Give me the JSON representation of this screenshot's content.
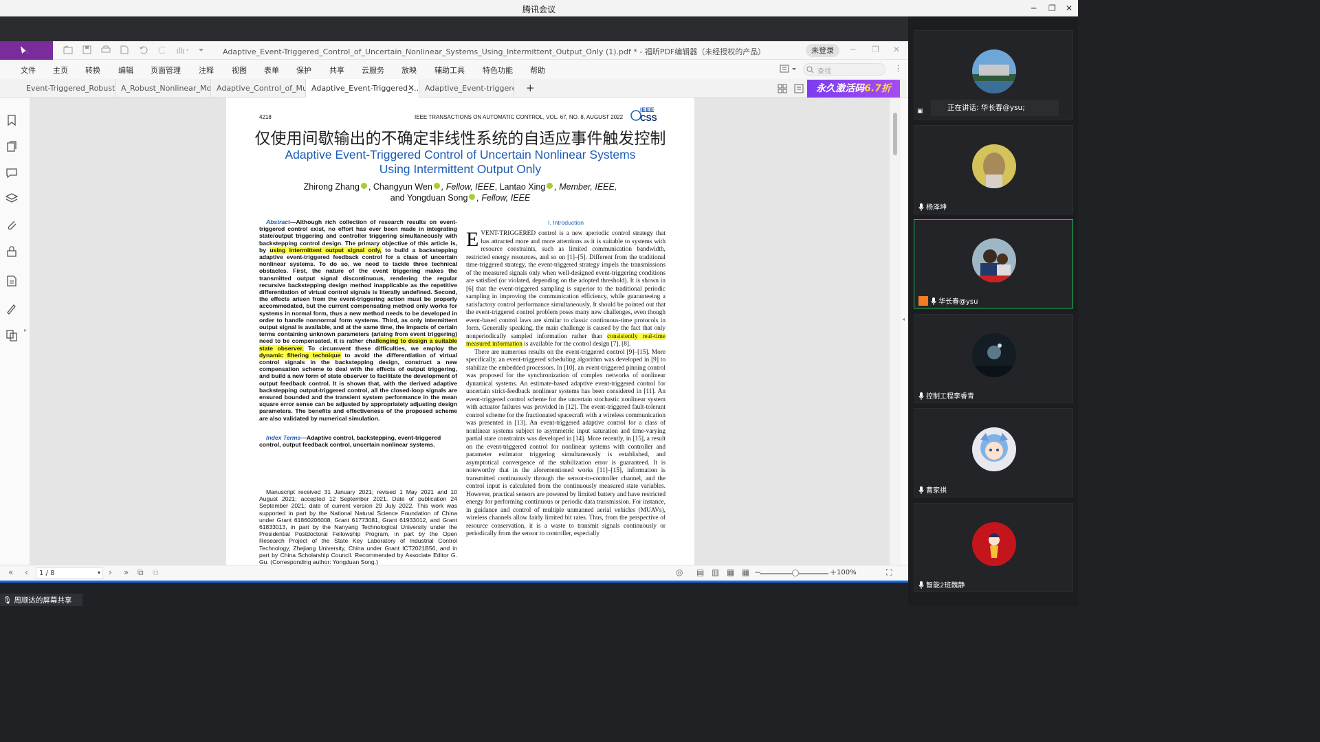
{
  "window": {
    "title": "腾讯会议",
    "controls": [
      "─",
      "❐",
      "✕"
    ]
  },
  "pdf": {
    "doc_title": "Adaptive_Event-Triggered_Control_of_Uncertain_Nonlinear_Systems_Using_Intermittent_Output_Only (1).pdf * - 福昕PDF编辑器（未经授权的产品）",
    "login_label": "未登录",
    "menu": [
      "文件",
      "主页",
      "转换",
      "编辑",
      "页面管理",
      "注释",
      "视图",
      "表单",
      "保护",
      "共享",
      "云服务",
      "放映",
      "辅助工具",
      "特色功能",
      "帮助"
    ],
    "search_placeholder": "查找",
    "tabs": [
      "Event-Triggered_Robust_...",
      "A_Robust_Nonlinear_Mod...",
      "Adaptive_Control_of_Multi...",
      "Adaptive_Event-Triggered_...",
      "Adaptive_Event-triggered..."
    ],
    "active_tab": 3,
    "add_tab": "+",
    "promo": {
      "text": "永久激活码",
      "accent": "6.7折"
    },
    "status": {
      "page": "1 / 8",
      "zoom": "100%"
    }
  },
  "paper": {
    "page_no": "4218",
    "journal": "IEEE TRANSACTIONS ON AUTOMATIC CONTROL, VOL. 67, NO. 8, AUGUST 2022",
    "logo_text": "IEEE CSS",
    "title_cn": "仅使用间歇输出的不确定非线性系统的自适应事件触发控制",
    "title_en_1": "Adaptive Event-Triggered Control of Uncertain Nonlinear Systems",
    "title_en_2": "Using Intermittent Output Only",
    "authors_1a": "Zhirong Zhang",
    "authors_1b": ", Changyun Wen",
    "authors_1c": ", Fellow, IEEE",
    "authors_1d": ", Lantao Xing",
    "authors_1e": ", Member, IEEE,",
    "authors_2a": "and Yongduan Song",
    "authors_2b": ", Fellow, IEEE",
    "abstract_label": "Abstract",
    "abstract_p1": "—Although rich collection of research results on event-triggered control exist, no effort has ever been made in integrating state/output triggering and controller triggering simultaneously with backstepping control design. The primary objective of this article is, by ",
    "abstract_h1": "using intermittent output signal only,",
    "abstract_p2": " to build a backstepping adaptive event-triggered feedback control for a class of uncertain nonlinear systems. To do so, we need to tackle three technical obstacles. First, the nature of the event triggering makes the transmitted output signal discontinuous, rendering the regular recursive backstepping design method inapplicable as the repetitive differentiation of virtual control signals is literally undefined. Second, the effects arisen from the event-triggering action must be properly accommodated, but the current compensating method only works for systems in normal form, thus a new method needs to be developed in order to handle nonnormal form systems. Third, as only intermittent output signal is available, and at the same time, the impacts of certain terms containing unknown parameters (arising from event triggering) need to be compensated, it is rather chal",
    "abstract_h2": "lenging to design a suitable state observer.",
    "abstract_p3": " To circumvent these difficulties, we employ the ",
    "abstract_h3": "dynamic filtering technique",
    "abstract_p4": " to avoid the differentiation of virtual control signals in the backstepping design, construct a new compensation scheme to deal with the effects of output triggering, and build a new form of state observer to facilitate the development of output feedback control. It is shown that, with the derived adaptive backstepping output-triggered control, all the closed-loop signals are ensured bounded and the transient system performance in the mean square error sense can be adjusted by appropriately adjusting design parameters. The benefits and effectiveness of the proposed scheme are also validated by numerical simulation.",
    "index_label": "Index Terms",
    "index_text": "—Adaptive control, backstepping, event-triggered control, output feedback control, uncertain nonlinear systems.",
    "manuscript": "Manuscript received 31 January 2021; revised 1 May 2021 and 10 August 2021; accepted 12 September 2021. Date of publication 24 September 2021; date of current version 29 July 2022. This work was supported in part by the National Natural Science Foundation of China under Grant 61860206008, Grant 61773081, Grant 61933012, and Grant 61833013, in part by the Nanyang Technological University under the Presidential Postdoctoral Fellowship Program, in part by the Open Research Project of the State Key Laboratory of Industrial Control Technology, Zhejiang University, China under Grant ICT2021B56, and in part by China Scholarship Council. Recommended by Associate Editor G. Gu. (Corresponding author: Yongduan Song.)",
    "section": "I. Introduction",
    "dropcap": "E",
    "intro_p1a": "VENT-TRIGGERED control is a new aperiodic control strategy that has attracted more and more attentions as it is suitable to systems with resource constraints, such as limited communication bandwidth, restricted energy resources, and so on [1]–[5]. Different from the traditional time-triggered strategy, the event-triggered strategy impels the transmissions of the measured signals only when well-designed event-triggering conditions are satisfied (or violated, depending on the adopted threshold). It is shown in [6] that the event-triggered sampling is superior to the traditional periodic sampling in improving the communication efficiency, while guaranteeing a satisfactory control performance simultaneously. It should be pointed out that the event-triggered control problem poses many new challenges, even though event-based control laws are similar to classic continuous-time protocols in form. Generally speaking, the main challenge is caused by the fact that only nonperiodically sampled information rather than ",
    "intro_h1": "consistently real-time measured information",
    "intro_p1b": " is available for the control design [7], [8].",
    "intro_p2": "There are numerous results on the event-triggered control [9]–[15]. More specifically, an event-triggered scheduling algorithm was developed in [9] to stabilize the embedded processors. In [10], an event-triggered pinning control was proposed for the synchronization of complex networks of nonlinear dynamical systems. An estimate-based adaptive event-triggered control for uncertain strict-feedback nonlinear systems has been considered in [11]. An event-triggered control scheme for the uncertain stochastic nonlinear system with actuator failures was provided in [12]. The event-triggered fault-tolerant control scheme for the fractionated spacecraft with a wireless communication was presented in [13]. An event-triggered adaptive control for a class of nonlinear systems subject to asymmetric input saturation and time-varying partial state constraints was developed in [14]. More recently, in [15], a result on the event-triggered control for nonlinear systems with controller and parameter estimator triggering simultaneously is established, and asymptotical convergence of the stabilization error is guaranteed. It is noteworthy that in the aforementioned works [11]–[15], information is transmitted continuously through the sensor-to-controller channel, and the control input is calculated from the continuously measured state variables. However, practical sensors are powered by limited battery and have restricted energy for performing continuous or periodic data transmission. For instance, in guidance and control of multiple unmanned aerial vehicles (MUAVs), wireless channels allow fairly limited bit rates. Thus, from the perspective of resource conservation, it is a waste to transmit signals continuously or periodically from the sensor to controller, especially"
  },
  "meeting": {
    "speaking": "正在讲话: 华长春@ysu;",
    "participants": [
      {
        "name": ""
      },
      {
        "name": "杨泽坤"
      },
      {
        "name": "华长春@ysu"
      },
      {
        "name": "控制工程李睿青"
      },
      {
        "name": "曹家祺"
      },
      {
        "name": "智能2班魏静"
      }
    ],
    "share_label": "周顺达的屏幕共享",
    "colors": {
      "active_border": "#19c25b",
      "share_bar": "#0b6cf0",
      "brand": "#7a2b9c"
    }
  }
}
